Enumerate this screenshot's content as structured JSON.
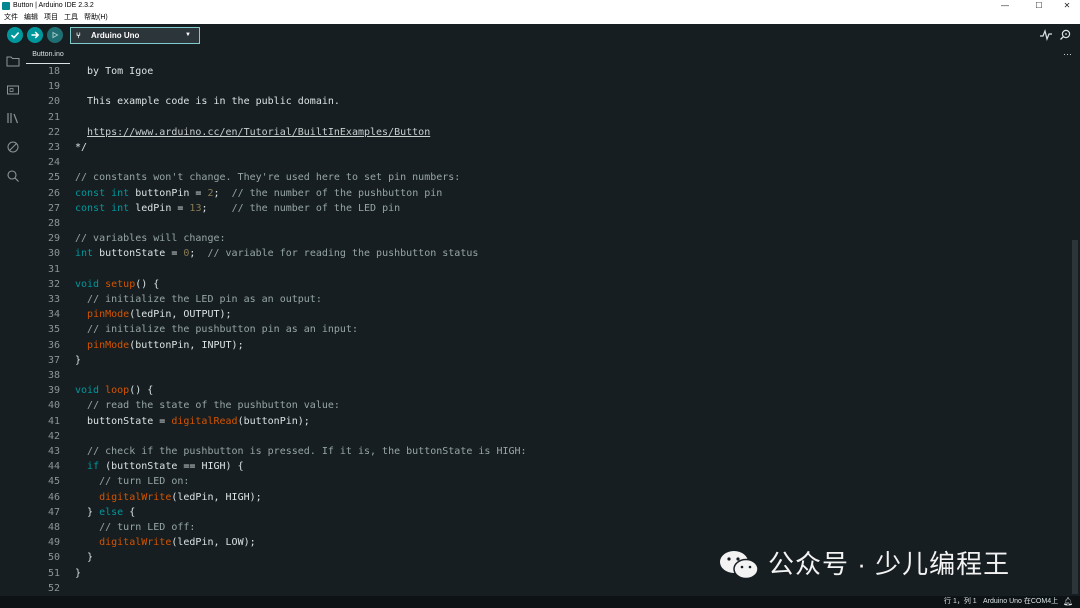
{
  "window": {
    "title": "Button | Arduino IDE 2.3.2",
    "controls": {
      "minimize": "—",
      "maximize": "☐",
      "close": "✕"
    }
  },
  "menu": [
    "文件",
    "编辑",
    "项目",
    "工具",
    "帮助(H)"
  ],
  "toolbar": {
    "verify_icon": "check-icon",
    "upload_icon": "arrow-right-icon",
    "debug_icon": "debug-icon",
    "board": "Arduino Uno",
    "serial_plotter_icon": "pulse-icon",
    "serial_monitor_icon": "magnifier-icon"
  },
  "sidebar": [
    "folder-icon",
    "board-icon",
    "library-icon",
    "debug-icon",
    "search-icon"
  ],
  "tab": {
    "label": "Button.ino",
    "more": "···"
  },
  "editor": {
    "lines": [
      {
        "n": "18",
        "html": "  by Tom Igoe"
      },
      {
        "n": "19",
        "html": ""
      },
      {
        "n": "20",
        "html": "  This example code is in the public domain."
      },
      {
        "n": "21",
        "html": ""
      },
      {
        "n": "22",
        "html": "  <span class=\"url\">https://www.arduino.cc/en/Tutorial/BuiltInExamples/Button</span>"
      },
      {
        "n": "23",
        "html": "*/"
      },
      {
        "n": "24",
        "html": ""
      },
      {
        "n": "25",
        "html": "<span class=\"cm\">// constants won't change. They're used here to set pin numbers:</span>"
      },
      {
        "n": "26",
        "html": "<span class=\"kw\">const</span> <span class=\"kw\">int</span> buttonPin = <span class=\"num\">2</span>;  <span class=\"cm\">// the number of the pushbutton pin</span>"
      },
      {
        "n": "27",
        "html": "<span class=\"kw\">const</span> <span class=\"kw\">int</span> ledPin = <span class=\"num\">13</span>;    <span class=\"cm\">// the number of the LED pin</span>"
      },
      {
        "n": "28",
        "html": ""
      },
      {
        "n": "29",
        "html": "<span class=\"cm\">// variables will change:</span>"
      },
      {
        "n": "30",
        "html": "<span class=\"kw\">int</span> buttonState = <span class=\"num\">0</span>;  <span class=\"cm\">// variable for reading the pushbutton status</span>"
      },
      {
        "n": "31",
        "html": ""
      },
      {
        "n": "32",
        "html": "<span class=\"kw\">void</span> <span class=\"fn\">setup</span>() {"
      },
      {
        "n": "33",
        "html": "  <span class=\"cm\">// initialize the LED pin as an output:</span>"
      },
      {
        "n": "34",
        "html": "  <span class=\"fn\">pinMode</span>(ledPin, OUTPUT);"
      },
      {
        "n": "35",
        "html": "  <span class=\"cm\">// initialize the pushbutton pin as an input:</span>"
      },
      {
        "n": "36",
        "html": "  <span class=\"fn\">pinMode</span>(buttonPin, INPUT);"
      },
      {
        "n": "37",
        "html": "}"
      },
      {
        "n": "38",
        "html": ""
      },
      {
        "n": "39",
        "html": "<span class=\"kw\">void</span> <span class=\"fn\">loop</span>() {"
      },
      {
        "n": "40",
        "html": "  <span class=\"cm\">// read the state of the pushbutton value:</span>"
      },
      {
        "n": "41",
        "html": "  buttonState = <span class=\"fn\">digitalRead</span>(buttonPin);"
      },
      {
        "n": "42",
        "html": ""
      },
      {
        "n": "43",
        "html": "  <span class=\"cm\">// check if the pushbutton is pressed. If it is, the buttonState is HIGH:</span>"
      },
      {
        "n": "44",
        "html": "  <span class=\"kw\">if</span> (buttonState == HIGH) {"
      },
      {
        "n": "45",
        "html": "    <span class=\"cm\">// turn LED on:</span>"
      },
      {
        "n": "46",
        "html": "    <span class=\"fn\">digitalWrite</span>(ledPin, HIGH);"
      },
      {
        "n": "47",
        "html": "  } <span class=\"kw\">else</span> {"
      },
      {
        "n": "48",
        "html": "    <span class=\"cm\">// turn LED off:</span>"
      },
      {
        "n": "49",
        "html": "    <span class=\"fn\">digitalWrite</span>(ledPin, LOW);"
      },
      {
        "n": "50",
        "html": "  }"
      },
      {
        "n": "51",
        "html": "}"
      },
      {
        "n": "52",
        "html": ""
      }
    ]
  },
  "status": {
    "position": "行 1，列 1",
    "board": "Arduino Uno 在COM4上",
    "bell_icon": "bell-icon"
  },
  "watermark": {
    "text": "公众号 · 少儿编程王",
    "logo_icon": "wechat-logo-icon"
  },
  "colors": {
    "accent": "#00979c",
    "background": "#171e21",
    "function": "#d35400",
    "comment": "#95a5a6"
  }
}
